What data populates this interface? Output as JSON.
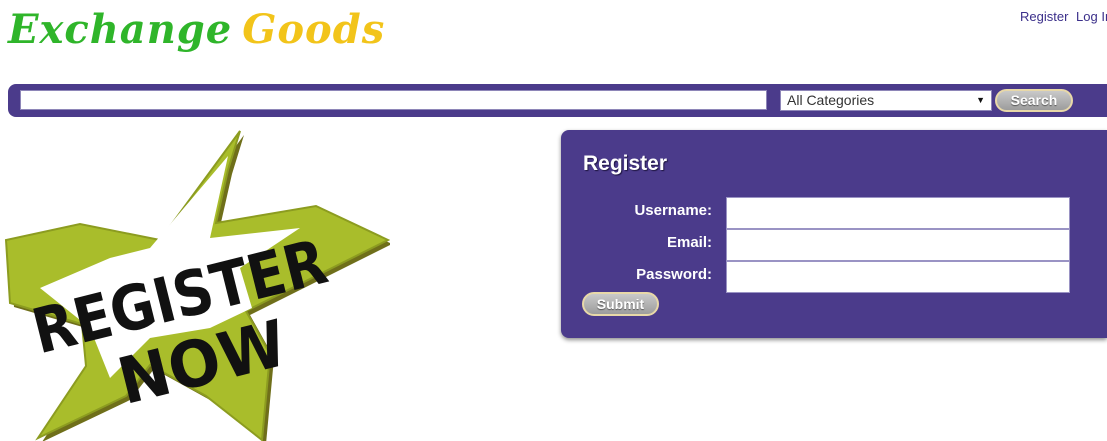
{
  "logo": {
    "word1": "Exchange",
    "word2": "Goods"
  },
  "top_links": {
    "register": "Register",
    "login": "Log In"
  },
  "search": {
    "input_value": "",
    "category_selected": "All Categories",
    "button_label": "Search"
  },
  "banner": {
    "line1": "REGISTER",
    "line2": "NOW"
  },
  "register_form": {
    "title": "Register",
    "username_label": "Username:",
    "email_label": "Email:",
    "password_label": "Password:",
    "username_value": "",
    "email_value": "",
    "password_value": "",
    "submit_label": "Submit"
  },
  "colors": {
    "brand_purple": "#4b3b8b",
    "logo_green": "#2fb52a",
    "logo_yellow": "#f2c41a",
    "star_green": "#a9bd2b"
  }
}
